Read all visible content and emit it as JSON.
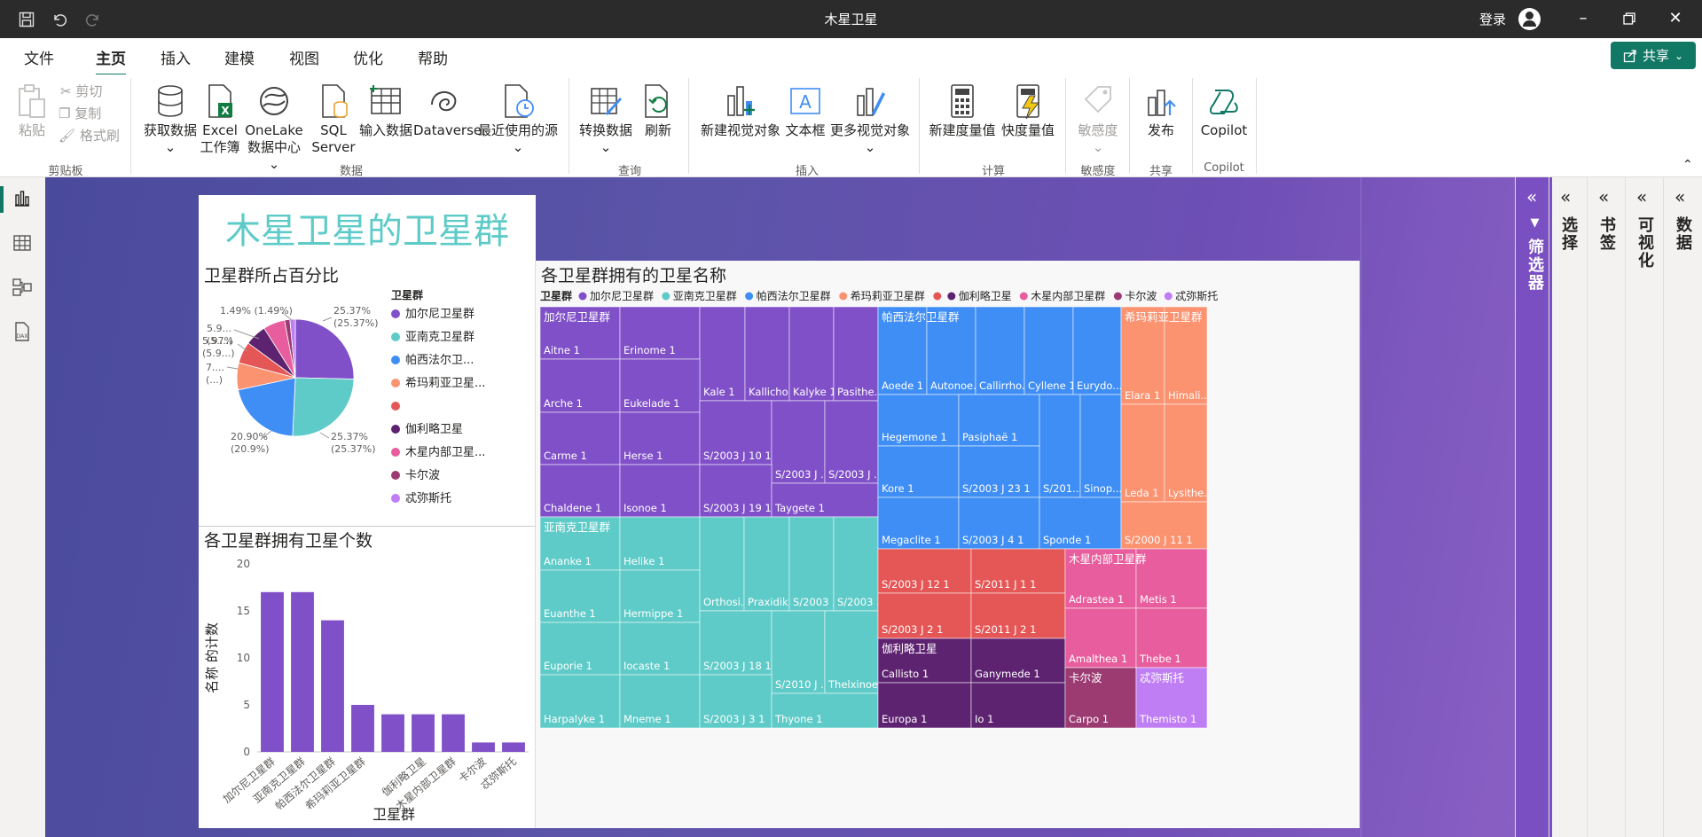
{
  "window": {
    "title": "木星卫星",
    "login": "登录"
  },
  "menu": {
    "tabs": [
      "文件",
      "主页",
      "插入",
      "建模",
      "视图",
      "优化",
      "帮助"
    ],
    "active": "主页",
    "share": "共享"
  },
  "ribbon": {
    "clipboard": {
      "paste": "粘贴",
      "cut": "剪切",
      "copy": "复制",
      "format": "格式刷",
      "group": "剪贴板"
    },
    "data": {
      "get_data": "获取数据",
      "excel_1": "Excel",
      "excel_2": "工作簿",
      "onelake_1": "OneLake",
      "onelake_2": "数据中心",
      "sql_1": "SQL",
      "sql_2": "Server",
      "enter_data": "输入数据",
      "dataverse": "Dataverse",
      "recent": "最近使用的源",
      "group": "数据"
    },
    "query": {
      "transform": "转换数据",
      "refresh": "刷新",
      "group": "查询"
    },
    "insert": {
      "new_visual": "新建视觉对象",
      "textbox": "文本框",
      "more_visuals": "更多视觉对象",
      "group": "插入"
    },
    "calc": {
      "new_measure": "新建度量值",
      "quick_measure": "快度量值",
      "group": "计算"
    },
    "sensitivity": {
      "label": "敏感度",
      "group": "敏感度"
    },
    "share": {
      "publish": "发布",
      "group": "共享"
    },
    "copilot": {
      "label": "Copilot",
      "group": "Copilot"
    }
  },
  "panes": {
    "filter": "筛选器",
    "selection": "选择",
    "bookmark": "书签",
    "visualize": "可视化",
    "data": "数据"
  },
  "report": {
    "title": "木星卫星的卫星群",
    "pie_title": "卫星群所占百分比",
    "bar_title": "各卫星群拥有卫星个数",
    "treemap_title": "各卫星群拥有的卫星名称",
    "legend_title": "卫星群"
  },
  "colors": {
    "加尔尼卫星群": "#8050c8",
    "亚南克卫星群": "#5ecbc8",
    "帕西法尔卫星群": "#3f8ef5",
    "希玛莉亚卫星群": "#fb9270",
    "blank": "#e55656",
    "伽利略卫星": "#5e2370",
    "木星内部卫星群": "#e75d9d",
    "卡尔波": "#9b3b72",
    "忒弥斯托": "#c07ef5"
  },
  "chart_data": [
    {
      "type": "pie",
      "title": "卫星群所占百分比",
      "legend_title": "卫星群",
      "legend_display": [
        "加尔尼卫星群",
        "亚南克卫星群",
        "帕西法尔卫...",
        "希玛莉亚卫星...",
        "",
        "伽利略卫星",
        "木星内部卫星...",
        "卡尔波",
        "忒弥斯托"
      ],
      "slices": [
        {
          "name": "加尔尼卫星群",
          "value": 25.37
        },
        {
          "name": "亚南克卫星群",
          "value": 25.37
        },
        {
          "name": "帕西法尔卫星群",
          "value": 20.9
        },
        {
          "name": "希玛莉亚卫星群",
          "value": 7.46
        },
        {
          "name": "",
          "value": 5.97
        },
        {
          "name": "伽利略卫星",
          "value": 5.97
        },
        {
          "name": "木星内部卫星群",
          "value": 5.97
        },
        {
          "name": "卡尔波",
          "value": 1.49
        },
        {
          "name": "忒弥斯托",
          "value": 1.49
        }
      ],
      "labels": [
        [
          "25.37%",
          "(25.37%)"
        ],
        [
          "25.37%",
          "(25.37%)"
        ],
        [
          "20.90%",
          "(20.9%)"
        ],
        [
          "7....",
          "(...)"
        ],
        [
          "5.97%",
          "(5.9...)"
        ],
        [
          "5.9...",
          "(5....)"
        ],
        [
          "1.49% (1.49%)"
        ]
      ],
      "legend_placement": "right"
    },
    {
      "type": "bar",
      "title": "各卫星群拥有卫星个数",
      "categories": [
        "加尔尼卫星群",
        "亚南克卫星群",
        "帕西法尔卫星群",
        "希玛莉亚卫星群",
        "",
        "伽利略卫星",
        "木星内部卫星群",
        "卡尔波",
        "忒弥斯托"
      ],
      "values": [
        17,
        17,
        14,
        5,
        4,
        4,
        4,
        1,
        1
      ],
      "xlabel": "卫星群",
      "ylabel": "名称 的计数",
      "ylim": [
        0,
        20
      ],
      "yticks": [
        0,
        5,
        10,
        15,
        20
      ],
      "grid": false
    },
    {
      "type": "treemap",
      "title": "各卫星群拥有的卫星名称",
      "legend_title": "卫星群",
      "groups": [
        {
          "name": "加尔尼卫星群",
          "items": [
            "Aitne 1",
            "Erinome 1",
            "Kale 1",
            "Kallicho...",
            "Kalyke 1",
            "Pasithe...",
            "Arche 1",
            "Eukelade 1",
            "Carme 1",
            "Herse 1",
            "S/2003 J 10 1",
            "S/2003 J ...",
            "S/2003 J ...",
            "Chaldene 1",
            "Isonoe 1",
            "S/2003 J 19 1",
            "Taygete 1"
          ]
        },
        {
          "name": "亚南克卫星群",
          "items": [
            "Ananke 1",
            "Helike 1",
            "Euanthe 1",
            "Hermippe 1",
            "Orthosi...",
            "Praxidik...",
            "S/2003 ...",
            "S/2003 ...",
            "Euporie 1",
            "Iocaste 1",
            "S/2003 J 18 1",
            "S/2010 J ...",
            "Thelxinoe 1",
            "Harpalyke 1",
            "Mneme 1",
            "S/2003 J 3 1",
            "Thyone 1"
          ]
        },
        {
          "name": "帕西法尔卫星群",
          "items": [
            "Aoede 1",
            "Autonoe...",
            "Callirrho...",
            "Cyllene 1",
            "Eurydo...",
            "Hegemone 1",
            "Pasiphaë 1",
            "Kore 1",
            "S/2003 J 23 1",
            "S/201...",
            "Sinop...",
            "Megaclite 1",
            "S/2003 J 4 1",
            "Sponde 1"
          ]
        },
        {
          "name": "希玛莉亚卫星群",
          "items": [
            "Elara 1",
            "Himali...",
            "Leda 1",
            "Lysithe...",
            "S/2000 J 11 1"
          ]
        },
        {
          "name": "",
          "items": [
            "S/2003 J 12 1",
            "S/2011 J 1 1",
            "S/2003 J 2 1",
            "S/2011 J 2 1"
          ]
        },
        {
          "name": "伽利略卫星",
          "items": [
            "Callisto 1",
            "Ganymede 1",
            "Europa 1",
            "Io 1"
          ]
        },
        {
          "name": "木星内部卫星群",
          "items": [
            "Adrastea 1",
            "Metis 1",
            "Amalthea 1",
            "Thebe 1"
          ]
        },
        {
          "name": "卡尔波",
          "items": [
            "Carpo 1"
          ]
        },
        {
          "name": "忒弥斯托",
          "items": [
            "Themisto 1"
          ]
        }
      ],
      "legend_placement": "top"
    }
  ]
}
